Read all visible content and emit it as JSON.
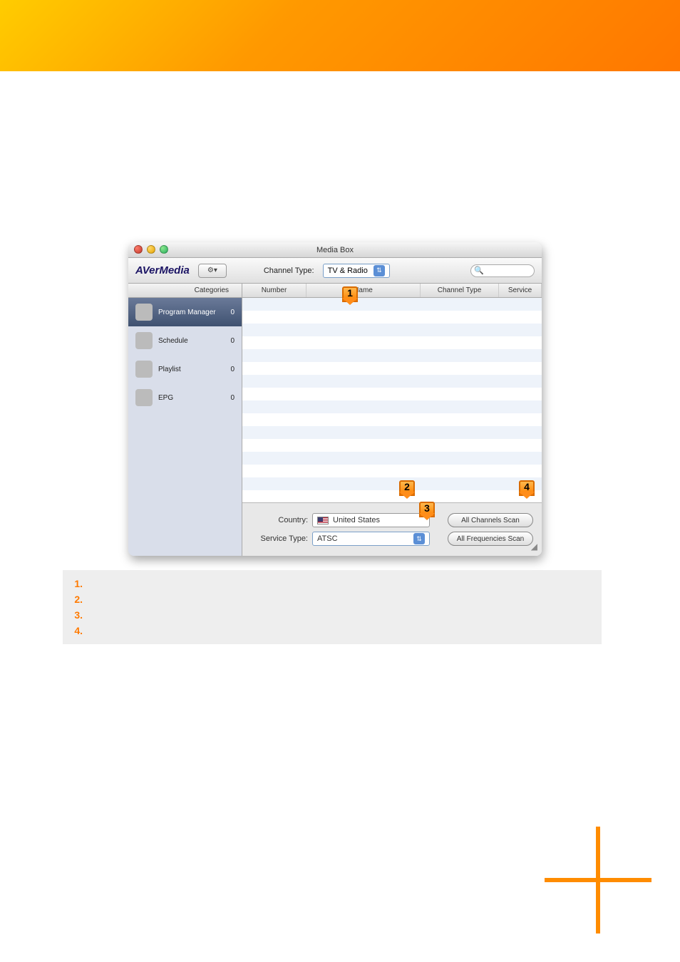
{
  "window": {
    "title": "Media Box",
    "logo": "AVerMedia",
    "channelTypeLabel": "Channel Type:",
    "channelTypeValue": "TV & Radio"
  },
  "sidebar": {
    "header": "Categories",
    "items": [
      {
        "label": "Program Manager",
        "count": "0"
      },
      {
        "label": "Schedule",
        "count": "0"
      },
      {
        "label": "Playlist",
        "count": "0"
      },
      {
        "label": "EPG",
        "count": "0"
      }
    ]
  },
  "columns": {
    "number": "Number",
    "name": "Name",
    "channelType": "Channel Type",
    "service": "Service"
  },
  "controls": {
    "countryLabel": "Country:",
    "countryValue": "United States",
    "serviceTypeLabel": "Service Type:",
    "serviceTypeValue": "ATSC",
    "allChannelsScan": "All Channels Scan",
    "allFrequenciesScan": "All Frequencies Scan"
  },
  "callouts": [
    "1",
    "2",
    "3",
    "4"
  ],
  "steps": [
    {
      "n": "1.",
      "t": ""
    },
    {
      "n": "2.",
      "t": ""
    },
    {
      "n": "3.",
      "t": ""
    },
    {
      "n": "4.",
      "t": ""
    }
  ]
}
